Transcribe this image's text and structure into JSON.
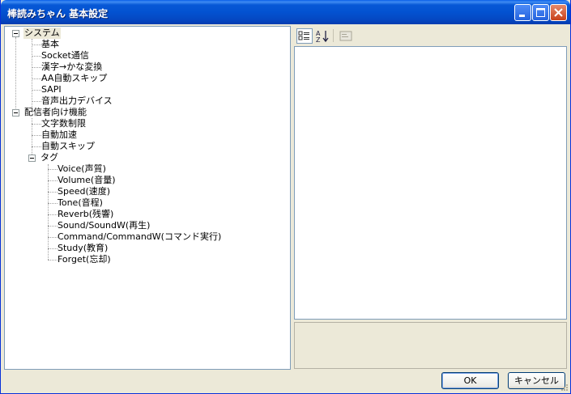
{
  "window": {
    "title": "棒読みちゃん 基本設定"
  },
  "tree": {
    "nodes": [
      {
        "label": "システム",
        "level": 0,
        "expanded": true,
        "selected": true
      },
      {
        "label": "基本",
        "level": 1
      },
      {
        "label": "Socket通信",
        "level": 1
      },
      {
        "label": "漢字→かな変換",
        "level": 1
      },
      {
        "label": "AA自動スキップ",
        "level": 1
      },
      {
        "label": "SAPI",
        "level": 1
      },
      {
        "label": "音声出力デバイス",
        "level": 1
      },
      {
        "label": "配信者向け機能",
        "level": 0,
        "expanded": true
      },
      {
        "label": "文字数制限",
        "level": 1
      },
      {
        "label": "自動加速",
        "level": 1
      },
      {
        "label": "自動スキップ",
        "level": 1
      },
      {
        "label": "タグ",
        "level": 1,
        "expanded": true
      },
      {
        "label": "Voice(声質)",
        "level": 2
      },
      {
        "label": "Volume(音量)",
        "level": 2
      },
      {
        "label": "Speed(速度)",
        "level": 2
      },
      {
        "label": "Tone(音程)",
        "level": 2
      },
      {
        "label": "Reverb(残響)",
        "level": 2
      },
      {
        "label": "Sound/SoundW(再生)",
        "level": 2
      },
      {
        "label": "Command/CommandW(コマンド実行)",
        "level": 2
      },
      {
        "label": "Study(教育)",
        "level": 2
      },
      {
        "label": "Forget(忘却)",
        "level": 2
      }
    ]
  },
  "propgrid": {
    "toolbar": {
      "categorized_icon": "categorized-icon",
      "alphabetical_icon": "sort-alphabetical-icon",
      "property_pages_icon": "property-pages-icon"
    }
  },
  "buttons": {
    "ok": "OK",
    "cancel": "キャンセル"
  },
  "colors": {
    "titlebar": "#0758d6",
    "face": "#ece9d8",
    "border": "#7f9db9"
  }
}
